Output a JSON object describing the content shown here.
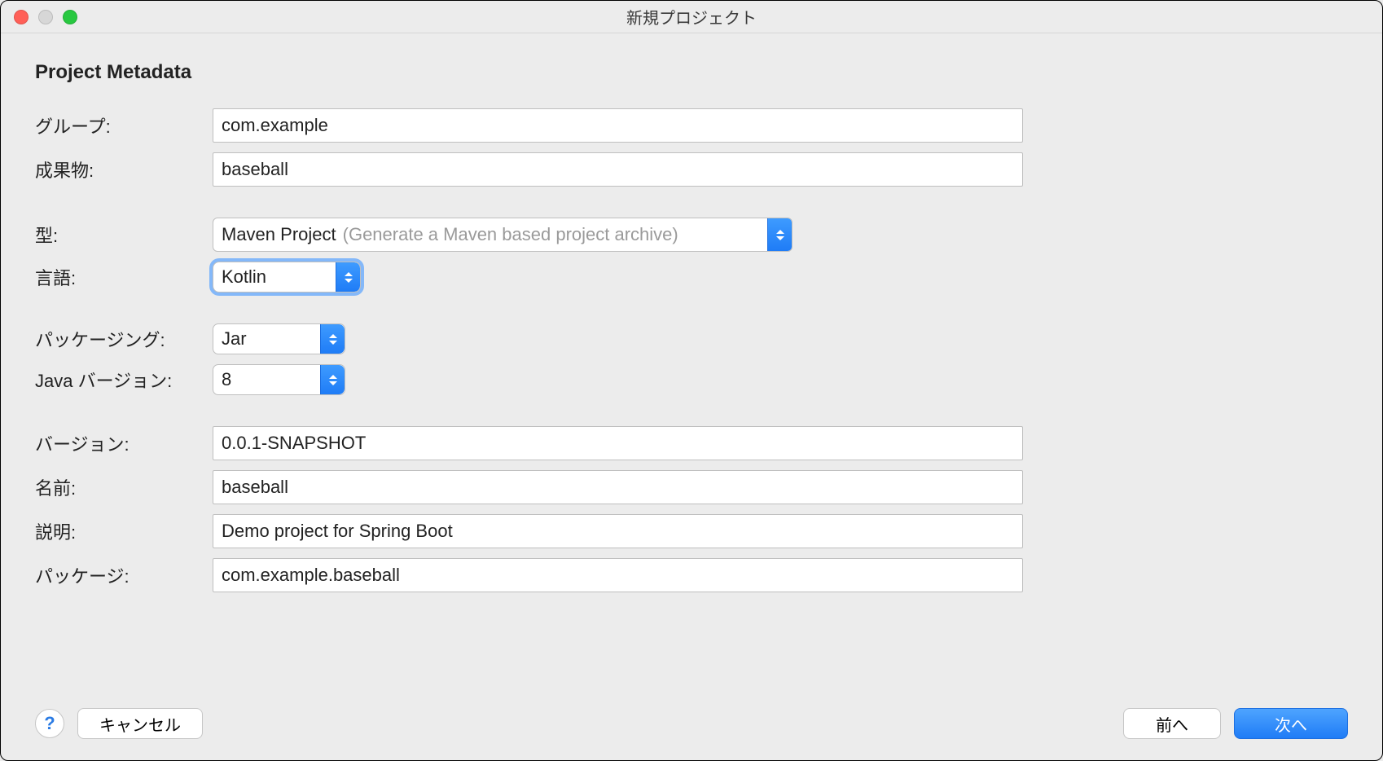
{
  "window": {
    "title": "新規プロジェクト"
  },
  "section": {
    "title": "Project Metadata"
  },
  "labels": {
    "group": "グループ:",
    "artifact": "成果物:",
    "type": "型:",
    "language": "言語:",
    "packaging": "パッケージング:",
    "javaVersion": "Java バージョン:",
    "version": "バージョン:",
    "name": "名前:",
    "description": "説明:",
    "package": "パッケージ:"
  },
  "values": {
    "group": "com.example",
    "artifact": "baseball",
    "type": "Maven Project",
    "typeHint": "(Generate a Maven based project archive)",
    "language": "Kotlin",
    "packaging": "Jar",
    "javaVersion": "8",
    "version": "0.0.1-SNAPSHOT",
    "name": "baseball",
    "description": "Demo project for Spring Boot",
    "package": "com.example.baseball"
  },
  "buttons": {
    "help": "?",
    "cancel": "キャンセル",
    "back": "前へ",
    "next": "次へ"
  }
}
